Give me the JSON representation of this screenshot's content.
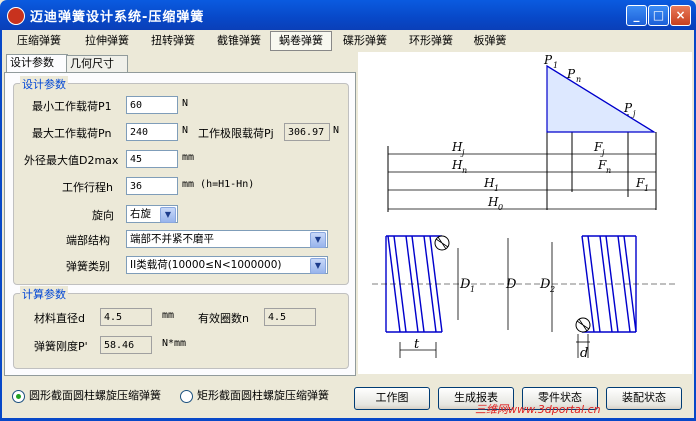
{
  "window": {
    "title": "迈迪弹簧设计系统-压缩弹簧",
    "min_label": "_",
    "max_label": "□",
    "close_label": "×"
  },
  "menu": [
    {
      "label": "压缩弹簧"
    },
    {
      "label": "拉伸弹簧"
    },
    {
      "label": "扭转弹簧"
    },
    {
      "label": "截锥弹簧"
    },
    {
      "label": "蜗卷弹簧"
    },
    {
      "label": "碟形弹簧"
    },
    {
      "label": "环形弹簧"
    },
    {
      "label": "板弹簧"
    }
  ],
  "tabs": [
    {
      "label": "设计参数"
    },
    {
      "label": "几何尺寸"
    }
  ],
  "design": {
    "group_title": "设计参数",
    "p1": {
      "label": "最小工作载荷P1",
      "value": "60",
      "unit": "N"
    },
    "pn": {
      "label": "最大工作载荷Pn",
      "value": "240",
      "unit": "N"
    },
    "pj": {
      "label": "工作极限载荷Pj",
      "value": "306.97",
      "unit": "N"
    },
    "d2max": {
      "label": "外径最大值D2max",
      "value": "45",
      "unit": "mm"
    },
    "h": {
      "label": "工作行程h",
      "value": "36",
      "unit": "mm (h=H1-Hn)"
    },
    "rotation": {
      "label": "旋向",
      "value": "右旋"
    },
    "end": {
      "label": "端部结构",
      "value": "端部不并紧不磨平"
    },
    "type": {
      "label": "弹簧类别",
      "value": "II类载荷(10000≤N<1000000)"
    }
  },
  "calc": {
    "group_title": "计算参数",
    "d": {
      "label": "材料直径d",
      "value": "4.5",
      "unit": "mm"
    },
    "n": {
      "label": "有效圈数n",
      "value": "4.5"
    },
    "pprime": {
      "label": "弹簧刚度P'",
      "value": "58.46",
      "unit": "N*mm"
    }
  },
  "drawing": {
    "labels": {
      "P1": "P",
      "P1sub": "1",
      "Pn": "P",
      "Pnsub": "n",
      "Pj": "P",
      "Pjsub": "j",
      "Hj": "H",
      "Hjsub": "j",
      "Hn": "H",
      "Hnsub": "n",
      "H1": "H",
      "H1sub": "1",
      "H0": "H",
      "H0sub": "0",
      "Fj": "F",
      "Fjsub": "j",
      "Fn": "F",
      "Fnsub": "n",
      "F1": "F",
      "F1sub": "1",
      "D1": "D",
      "D1sub": "1",
      "D": "D",
      "D2": "D",
      "D2sub": "2",
      "t": "t",
      "d": "d"
    },
    "line_color": "#0000cc"
  },
  "bottom": {
    "radio_round": "圆形截面圆柱螺旋压缩弹簧",
    "radio_rect": "矩形截面圆柱螺旋压缩弹簧",
    "btn_drawing": "工作图",
    "btn_report": "生成报表",
    "btn_part": "零件状态",
    "btn_assembly": "装配状态"
  },
  "watermark": "三维网www.3dportal.cn"
}
